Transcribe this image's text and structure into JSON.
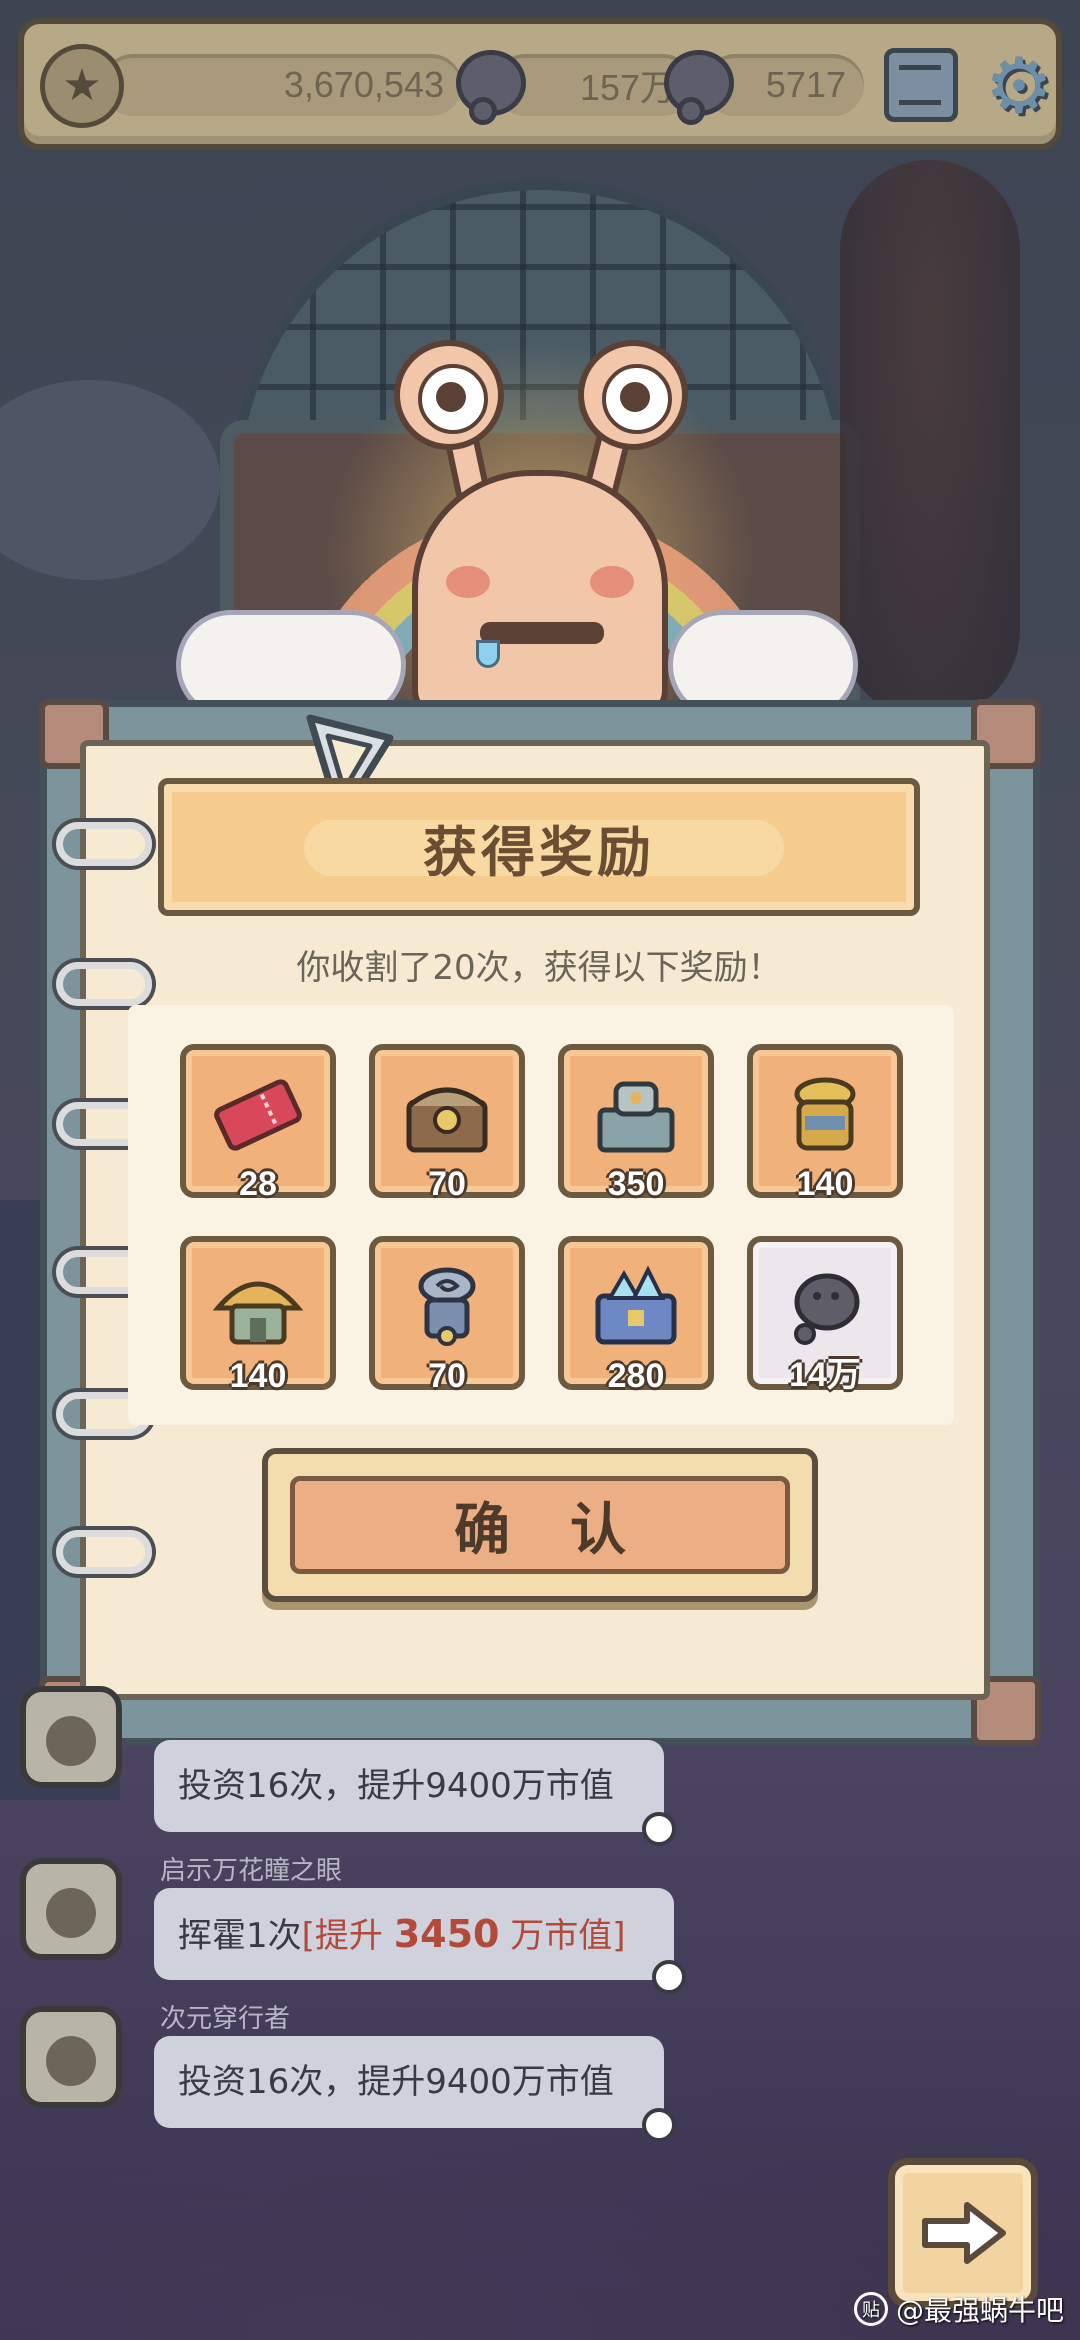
{
  "topbar": {
    "money": "3,670,543",
    "currency_a": "157万",
    "currency_b": "5717",
    "icons": [
      "rank-emblem-icon",
      "speech-bubble-icon",
      "speech-bubble-icon",
      "mail-icon",
      "gear-icon"
    ]
  },
  "reward_panel": {
    "title": "获得奖励",
    "subtitle": "你收割了20次，获得以下奖励！",
    "items": [
      {
        "icon": "ticket-icon",
        "count": "28",
        "color": "#d9485a"
      },
      {
        "icon": "ornate-chest-icon",
        "count": "70",
        "color": "#8e6a4c"
      },
      {
        "icon": "machine-chest-icon",
        "count": "350",
        "color": "#8aa3a8"
      },
      {
        "icon": "golden-urn-icon",
        "count": "140",
        "color": "#d6a94a"
      },
      {
        "icon": "mushroom-house-icon",
        "count": "140",
        "color": "#c9a45a"
      },
      {
        "icon": "spiral-totem-icon",
        "count": "70",
        "color": "#7b8fae"
      },
      {
        "icon": "crystal-chest-icon",
        "count": "280",
        "color": "#6d88c2"
      },
      {
        "icon": "gray-blob-icon",
        "count": "14万",
        "color": "#5f5d68"
      }
    ],
    "confirm_label": "确认"
  },
  "chat": [
    {
      "name": "",
      "message": "投资16次，提升9400万市值"
    },
    {
      "name": "启示万花瞳之眼",
      "message_prefix": "挥霍1次",
      "bracket_open": "[",
      "message_mid": "提升 ",
      "highlight": "3450",
      "message_suffix": " 万市值",
      "bracket_close": "]"
    },
    {
      "name": "次元穿行者",
      "message": "投资16次，提升9400万市值"
    }
  ],
  "watermark": {
    "logo": "贴",
    "text": "@最强蜗牛吧"
  },
  "colors": {
    "accent_orange": "#f0b27a",
    "paper": "#f6ead2",
    "highlight_red": "#b24a3a"
  }
}
